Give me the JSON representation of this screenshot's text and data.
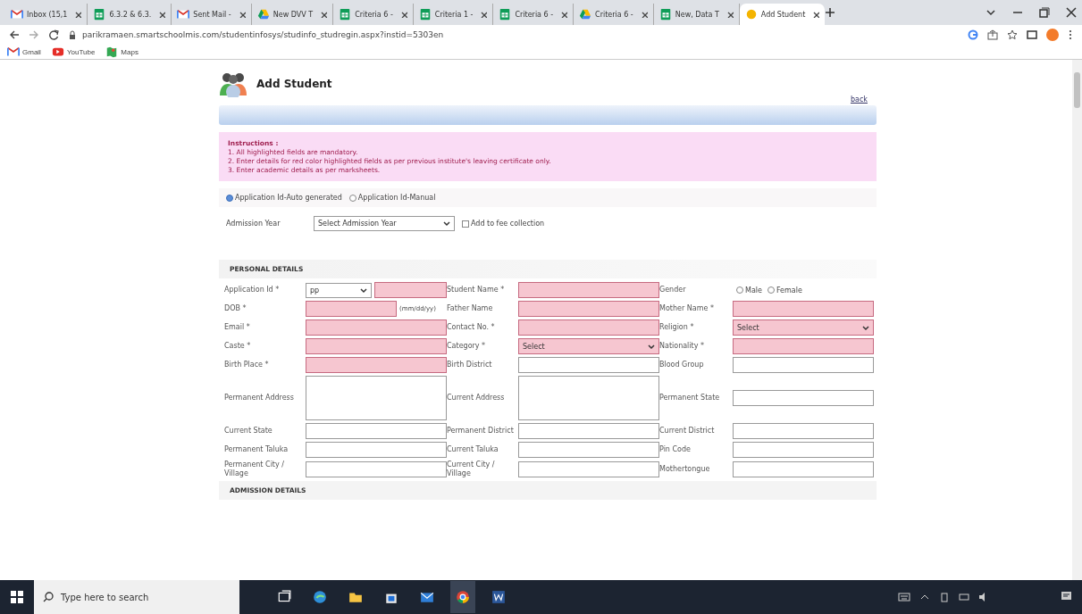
{
  "browser": {
    "tabs": [
      {
        "label": "Inbox (15,1",
        "kind": "mail",
        "selected": false
      },
      {
        "label": "6.3.2 & 6.3.",
        "kind": "sheet",
        "selected": false
      },
      {
        "label": "Sent Mail -",
        "kind": "mail",
        "selected": false
      },
      {
        "label": "New DVV T",
        "kind": "drive",
        "selected": false
      },
      {
        "label": "Criteria 6 -",
        "kind": "sheet",
        "selected": false
      },
      {
        "label": "Criteria 1 -",
        "kind": "sheet",
        "selected": false
      },
      {
        "label": "Criteria 6 -",
        "kind": "sheet",
        "selected": false
      },
      {
        "label": "Criteria 6 -",
        "kind": "drive",
        "selected": false
      },
      {
        "label": "New, Data T",
        "kind": "sheet",
        "selected": false
      },
      {
        "label": "Add Student",
        "kind": "site",
        "selected": true
      }
    ],
    "url": "parikramaen.smartschoolmis.com/studentinfosys/studinfo_studregin.aspx?instid=5303en",
    "bookmarks": [
      {
        "label": "Gmail",
        "kind": "mail"
      },
      {
        "label": "YouTube",
        "kind": "video"
      },
      {
        "label": "Maps",
        "kind": "map"
      }
    ]
  },
  "page": {
    "title": "Add Student",
    "back_link": "back",
    "instructions": {
      "heading": "Instructions :",
      "items": [
        "1. All highlighted fields are mandatory.",
        "2. Enter details for red color highlighted fields as per previous institute's leaving certificate only.",
        "3. Enter academic details as per marksheets."
      ]
    },
    "id_mode": [
      {
        "label": "Application Id-Auto generated",
        "selected": true
      },
      {
        "label": "Application Id-Manual",
        "selected": false
      }
    ],
    "admission_year": {
      "label": "Admission Year",
      "value": "Select Admission Year"
    },
    "add_fee": {
      "label": "Add to fee collection",
      "checked": false
    },
    "personal_heading": "PERSONAL DETAILS",
    "rows": [
      {
        "cells": [
          {
            "label": "Application Id *",
            "kind": "prefixed",
            "value": "pp",
            "highlighted": true
          },
          {
            "label": "Student Name *",
            "kind": "text",
            "highlighted": true
          },
          {
            "label": "Gender",
            "kind": "radio",
            "options": [
              {
                "label": "Male",
                "selected": false
              },
              {
                "label": "Female",
                "selected": false
              }
            ]
          }
        ]
      },
      {
        "cells": [
          {
            "label": "DOB *",
            "kind": "date",
            "hint": "(mm/dd/yy)",
            "highlighted": true
          },
          {
            "label": "Father Name",
            "kind": "text",
            "highlighted": true
          },
          {
            "label": "Mother Name *",
            "kind": "text",
            "highlighted": true
          }
        ]
      },
      {
        "cells": [
          {
            "label": "Email *",
            "kind": "text",
            "highlighted": true
          },
          {
            "label": "Contact No. *",
            "kind": "text",
            "highlighted": true
          },
          {
            "label": "Religion *",
            "kind": "select",
            "value": "Select",
            "highlighted": true
          }
        ]
      },
      {
        "cells": [
          {
            "label": "Caste *",
            "kind": "text",
            "highlighted": true
          },
          {
            "label": "Category *",
            "kind": "select",
            "value": "Select",
            "highlighted": true
          },
          {
            "label": "Nationality *",
            "kind": "text",
            "highlighted": true
          }
        ]
      },
      {
        "cells": [
          {
            "label": "Birth Place *",
            "kind": "text",
            "highlighted": true
          },
          {
            "label": "Birth District",
            "kind": "text",
            "highlighted": false
          },
          {
            "label": "Blood Group",
            "kind": "text",
            "highlighted": false
          }
        ]
      },
      {
        "cells": [
          {
            "label": "Permanent Address",
            "kind": "textarea",
            "highlighted": false
          },
          {
            "label": "Current Address",
            "kind": "textarea",
            "highlighted": false
          },
          {
            "label": "Permanent State",
            "kind": "text",
            "highlighted": false
          }
        ]
      },
      {
        "cells": [
          {
            "label": "Current State",
            "kind": "text",
            "highlighted": false
          },
          {
            "label": "Permanent District",
            "kind": "text",
            "highlighted": false
          },
          {
            "label": "Current District",
            "kind": "text",
            "highlighted": false
          }
        ]
      },
      {
        "cells": [
          {
            "label": "Permanent Taluka",
            "kind": "text",
            "highlighted": false
          },
          {
            "label": "Current Taluka",
            "kind": "text",
            "highlighted": false
          },
          {
            "label": "Pin Code",
            "kind": "text",
            "highlighted": false
          }
        ]
      },
      {
        "cells": [
          {
            "label": "Permanent City / Village",
            "kind": "text",
            "highlighted": false
          },
          {
            "label": "Current City / Village",
            "kind": "text",
            "highlighted": false
          },
          {
            "label": "Mothertongue",
            "kind": "text",
            "highlighted": false
          }
        ]
      }
    ],
    "admission_heading": "ADMISSION DETAILS"
  },
  "taskbar": {
    "search_placeholder": "Type here to search",
    "apps": [
      {
        "kind": "taskview"
      },
      {
        "kind": "edge"
      },
      {
        "kind": "folder"
      },
      {
        "kind": "store"
      },
      {
        "kind": "mail"
      },
      {
        "kind": "chrome"
      },
      {
        "kind": "word"
      }
    ]
  }
}
